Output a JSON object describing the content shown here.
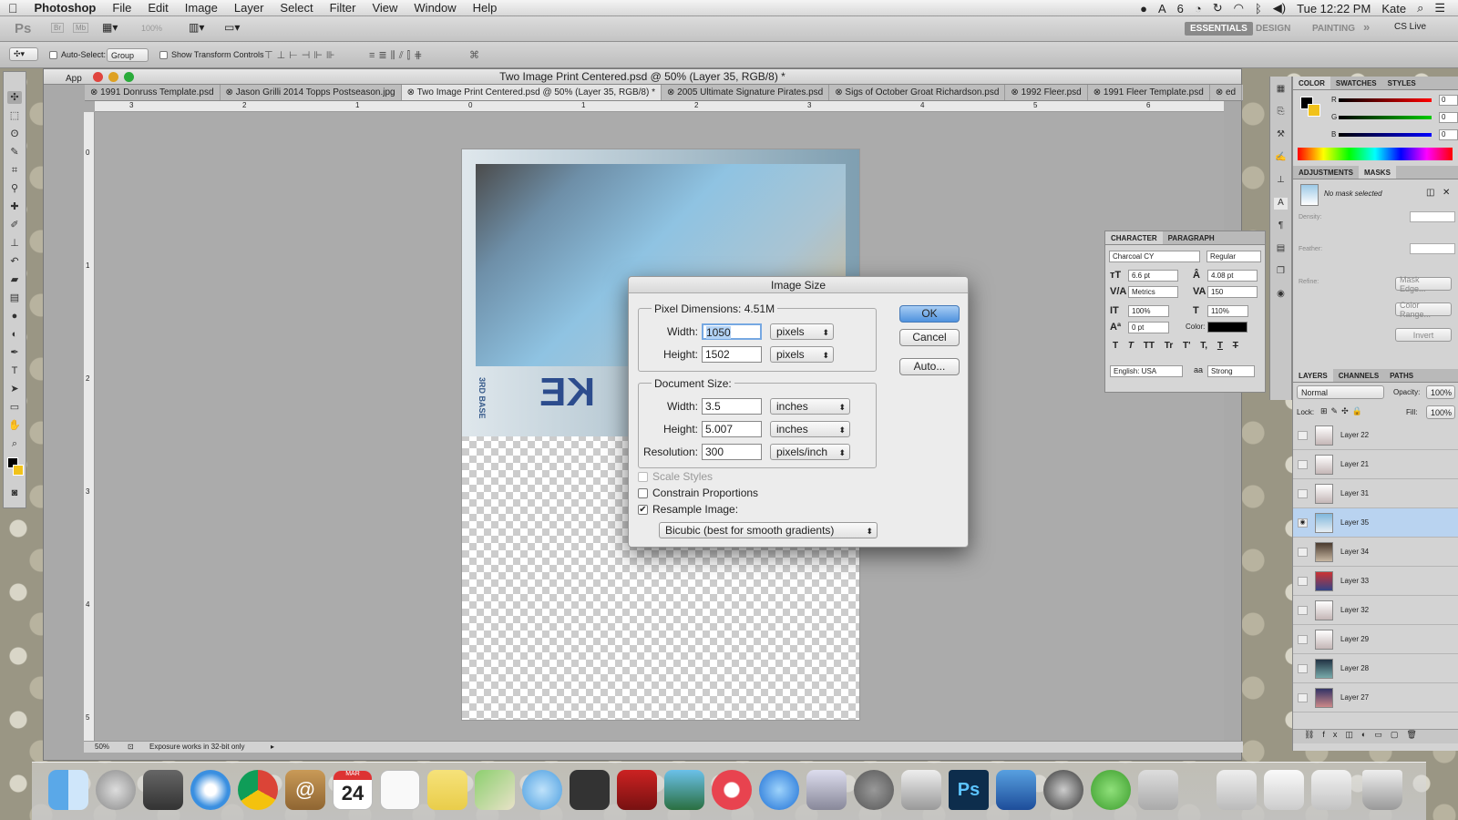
{
  "menubar": {
    "app": "Photoshop",
    "items": [
      "File",
      "Edit",
      "Image",
      "Layer",
      "Select",
      "Filter",
      "View",
      "Window",
      "Help"
    ],
    "status_num": "6",
    "clock": "Tue 12:22 PM",
    "user": "Kate"
  },
  "topbar": {
    "logo": "Ps",
    "br": "Br",
    "mb": "Mb",
    "zoom": "100%",
    "workspaces": [
      "ESSENTIALS",
      "DESIGN",
      "PAINTING"
    ],
    "more": "»",
    "cslive": "CS Live"
  },
  "options": {
    "auto_select": "Auto-Select:",
    "group": "Group",
    "show_transform": "Show Transform Controls"
  },
  "document": {
    "title": "Two Image Print Centered.psd @ 50% (Layer 35, RGB/8) *",
    "app_label": "App",
    "tabs": [
      "1991 Donruss Template.psd",
      "Jason Grilli 2014 Topps Postseason.jpg",
      "Two Image Print Centered.psd @ 50% (Layer 35, RGB/8) *",
      "2005 Ultimate Signature Pirates.psd",
      "Sigs of October Groat Richardson.psd",
      "1992 Fleer.psd",
      "1991 Fleer Template.psd",
      "ed"
    ],
    "ruler_h": [
      "3",
      "2",
      "1",
      "0",
      "1",
      "2",
      "3",
      "4",
      "5",
      "6"
    ],
    "ruler_v": [
      "0",
      "1",
      "2",
      "3",
      "4",
      "5"
    ],
    "status_zoom": "50%",
    "status_msg": "Exposure works in 32-bit only",
    "card_position": "3RD BASE",
    "card_bigtext": "KE"
  },
  "dialog": {
    "title": "Image Size",
    "pixel_dims_label": "Pixel Dimensions:",
    "pixel_dims_value": "4.51M",
    "px_width_label": "Width:",
    "px_width": "1050",
    "px_height_label": "Height:",
    "px_height": "1502",
    "px_unit": "pixels",
    "doc_size_label": "Document Size:",
    "doc_width_label": "Width:",
    "doc_width": "3.5",
    "doc_height_label": "Height:",
    "doc_height": "5.007",
    "doc_unit": "inches",
    "resolution_label": "Resolution:",
    "resolution": "300",
    "res_unit": "pixels/inch",
    "scale_styles": "Scale Styles",
    "constrain": "Constrain Proportions",
    "resample": "Resample Image:",
    "resample_method": "Bicubic (best for smooth gradients)",
    "ok": "OK",
    "cancel": "Cancel",
    "auto": "Auto..."
  },
  "character": {
    "tabs": [
      "CHARACTER",
      "PARAGRAPH"
    ],
    "font": "Charcoal CY",
    "style": "Regular",
    "size": "6.6 pt",
    "leading": "4.08 pt",
    "kerning": "Metrics",
    "tracking": "150",
    "vscale": "100%",
    "hscale": "110%",
    "baseline": "0 pt",
    "color_label": "Color:",
    "format_buttons": [
      "T",
      "T",
      "TT",
      "Tr",
      "T'",
      "T,",
      "T",
      "T"
    ],
    "language": "English: USA",
    "aa_label": "aa",
    "aa": "Strong"
  },
  "color_panel": {
    "tabs": [
      "COLOR",
      "SWATCHES",
      "STYLES"
    ],
    "channels": [
      {
        "label": "R",
        "value": "0"
      },
      {
        "label": "G",
        "value": "0"
      },
      {
        "label": "B",
        "value": "0"
      }
    ]
  },
  "masks_panel": {
    "tabs": [
      "ADJUSTMENTS",
      "MASKS"
    ],
    "no_mask": "No mask selected",
    "density": "Density:",
    "feather": "Feather:",
    "refine": "Refine:",
    "mask_edge": "Mask Edge...",
    "color_range": "Color Range...",
    "invert": "Invert"
  },
  "layers_panel": {
    "tabs": [
      "LAYERS",
      "CHANNELS",
      "PATHS"
    ],
    "blend": "Normal",
    "opacity_label": "Opacity:",
    "opacity": "100%",
    "lock_label": "Lock:",
    "fill_label": "Fill:",
    "fill": "100%",
    "layers": [
      "Layer 22",
      "Layer 21",
      "Layer 31",
      "Layer 35",
      "Layer 34",
      "Layer 33",
      "Layer 32",
      "Layer 29",
      "Layer 28",
      "Layer 27"
    ],
    "selected": "Layer 35"
  },
  "dock": {
    "calendar_month": "MAR",
    "calendar_day": "24",
    "ps_label": "Ps"
  },
  "colors": {
    "accent": "#4f92de",
    "selection": "#b9d3f0"
  }
}
